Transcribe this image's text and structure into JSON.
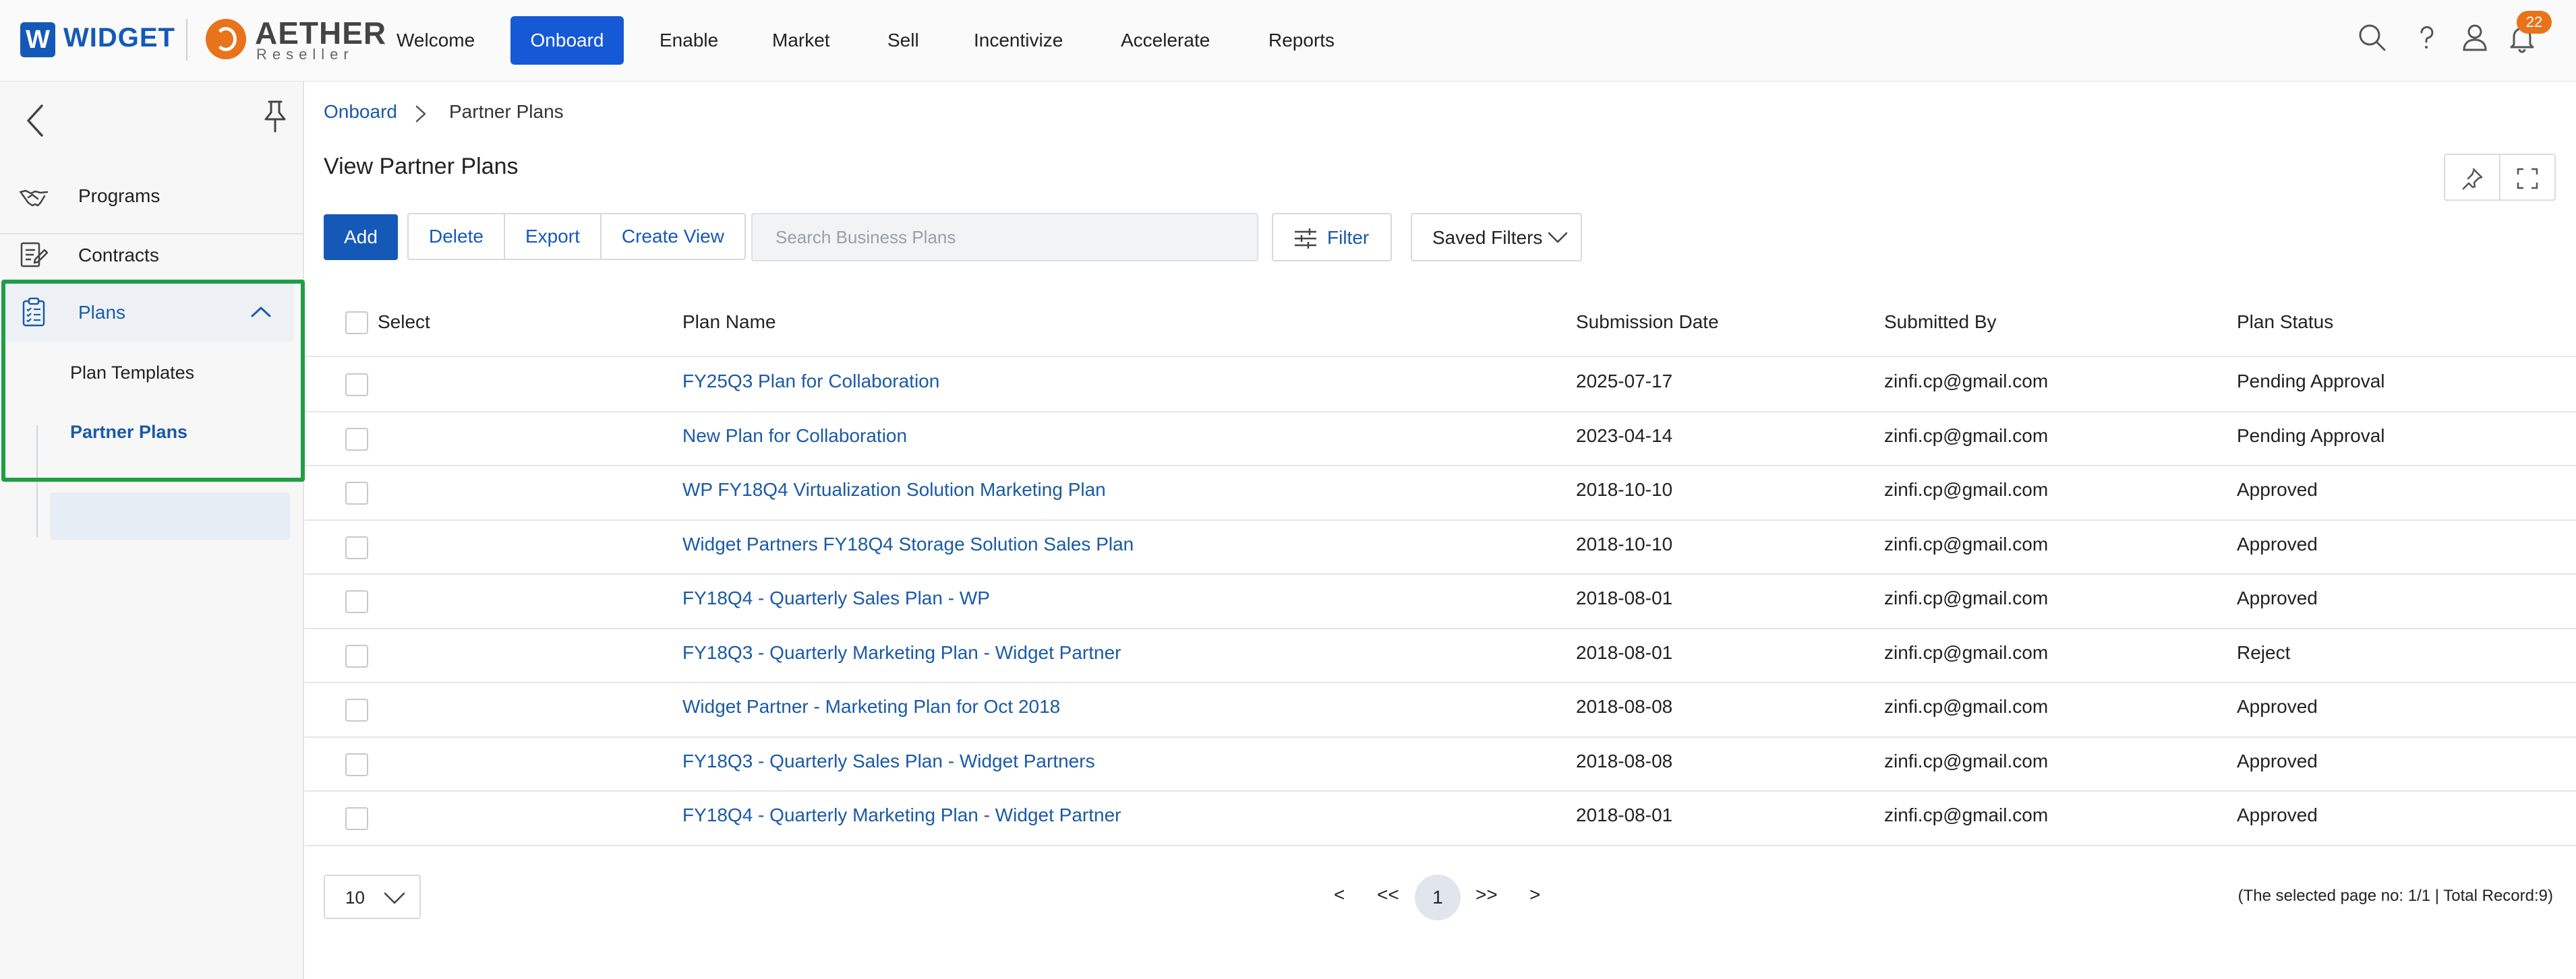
{
  "brand": {
    "logo_letter": "W",
    "name": "WIDGET",
    "partner_title": "AETHER",
    "partner_sub": "Reseller"
  },
  "nav": [
    "Welcome",
    "Onboard",
    "Enable",
    "Market",
    "Sell",
    "Incentivize",
    "Accelerate",
    "Reports"
  ],
  "nav_active": "Onboard",
  "notifications": {
    "count": "22"
  },
  "colors": {
    "accent": "#1559b8",
    "active_nav": "#1559d6",
    "brand_orange": "#e8731a",
    "highlight_green": "#1f9e46",
    "link": "#1a5aa6"
  },
  "sidebar": {
    "items": [
      {
        "label": "Programs",
        "icon": "handshake-icon"
      },
      {
        "label": "Contracts",
        "icon": "contract-edit-icon"
      },
      {
        "label": "Plans",
        "icon": "clipboard-list-icon",
        "expanded": true
      }
    ],
    "sub_items": [
      "Plan Templates",
      "Partner Plans"
    ],
    "active_sub": "Partner Plans"
  },
  "breadcrumb": {
    "parent": "Onboard",
    "current": "Partner Plans"
  },
  "page_title": "View Partner Plans",
  "toolbar": {
    "add": "Add",
    "delete": "Delete",
    "export": "Export",
    "create_view": "Create View",
    "search_placeholder": "Search Business Plans",
    "filter": "Filter",
    "saved_filters": "Saved Filters"
  },
  "table": {
    "headers": {
      "select": "Select",
      "plan_name": "Plan Name",
      "submission_date": "Submission Date",
      "submitted_by": "Submitted By",
      "plan_status": "Plan Status"
    },
    "rows": [
      {
        "name": "FY25Q3 Plan for Collaboration",
        "date": "2025-07-17",
        "by": "zinfi.cp@gmail.com",
        "status": "Pending Approval"
      },
      {
        "name": "New Plan for Collaboration",
        "date": "2023-04-14",
        "by": "zinfi.cp@gmail.com",
        "status": "Pending Approval"
      },
      {
        "name": "WP FY18Q4 Virtualization Solution Marketing Plan",
        "date": "2018-10-10",
        "by": "zinfi.cp@gmail.com",
        "status": "Approved"
      },
      {
        "name": "Widget Partners FY18Q4 Storage Solution Sales Plan",
        "date": "2018-10-10",
        "by": "zinfi.cp@gmail.com",
        "status": "Approved"
      },
      {
        "name": "FY18Q4 - Quarterly Sales Plan - WP",
        "date": "2018-08-01",
        "by": "zinfi.cp@gmail.com",
        "status": "Approved"
      },
      {
        "name": "FY18Q3 - Quarterly Marketing Plan - Widget Partner",
        "date": "2018-08-01",
        "by": "zinfi.cp@gmail.com",
        "status": "Reject"
      },
      {
        "name": "Widget Partner - Marketing Plan for Oct 2018",
        "date": "2018-08-08",
        "by": "zinfi.cp@gmail.com",
        "status": "Approved"
      },
      {
        "name": "FY18Q3 - Quarterly Sales Plan - Widget Partners",
        "date": "2018-08-08",
        "by": "zinfi.cp@gmail.com",
        "status": "Approved"
      },
      {
        "name": "FY18Q4 - Quarterly Marketing Plan - Widget Partner",
        "date": "2018-08-01",
        "by": "zinfi.cp@gmail.com",
        "status": "Approved"
      }
    ]
  },
  "pagination": {
    "page_size": "10",
    "prev": "<",
    "first": "<<",
    "current": "1",
    "last": ">>",
    "next": ">",
    "info": "(The selected page no: 1/1 | Total Record:9)"
  }
}
